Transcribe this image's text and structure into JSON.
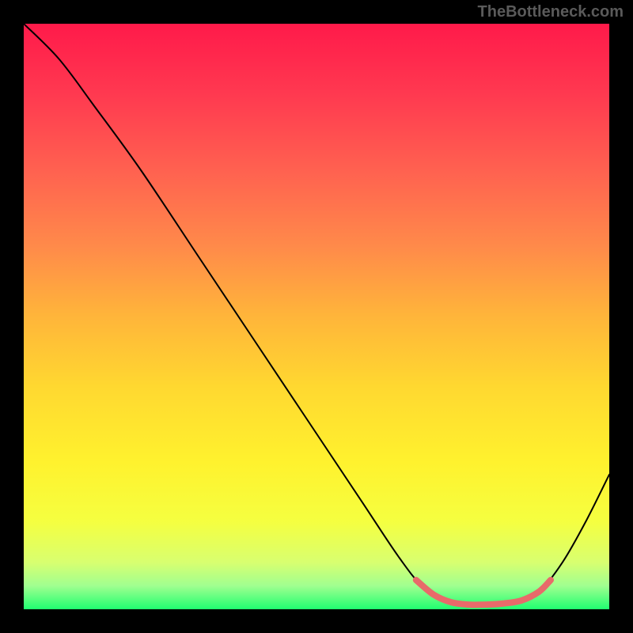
{
  "watermark": "TheBottleneck.com",
  "chart_data": {
    "type": "line",
    "title": "",
    "xlabel": "",
    "ylabel": "",
    "xlim": [
      0,
      100
    ],
    "ylim": [
      0,
      100
    ],
    "gradient_stops": [
      {
        "offset": 0,
        "color": "#ff1a4a"
      },
      {
        "offset": 12,
        "color": "#ff3950"
      },
      {
        "offset": 25,
        "color": "#ff6150"
      },
      {
        "offset": 38,
        "color": "#ff8a4a"
      },
      {
        "offset": 50,
        "color": "#ffb53a"
      },
      {
        "offset": 62,
        "color": "#ffd830"
      },
      {
        "offset": 75,
        "color": "#fff22e"
      },
      {
        "offset": 85,
        "color": "#f5ff40"
      },
      {
        "offset": 92,
        "color": "#d8ff70"
      },
      {
        "offset": 96,
        "color": "#a0ff90"
      },
      {
        "offset": 100,
        "color": "#20ff70"
      }
    ],
    "series": [
      {
        "name": "bottleneck-curve",
        "color": "#000000",
        "width": 2,
        "points": [
          {
            "x": 0,
            "y": 100
          },
          {
            "x": 6,
            "y": 94
          },
          {
            "x": 12,
            "y": 86
          },
          {
            "x": 20,
            "y": 75
          },
          {
            "x": 30,
            "y": 60
          },
          {
            "x": 40,
            "y": 45
          },
          {
            "x": 50,
            "y": 30
          },
          {
            "x": 58,
            "y": 18
          },
          {
            "x": 64,
            "y": 9
          },
          {
            "x": 68,
            "y": 4
          },
          {
            "x": 72,
            "y": 1.5
          },
          {
            "x": 76,
            "y": 0.8
          },
          {
            "x": 80,
            "y": 0.8
          },
          {
            "x": 84,
            "y": 1.2
          },
          {
            "x": 88,
            "y": 3
          },
          {
            "x": 92,
            "y": 8
          },
          {
            "x": 96,
            "y": 15
          },
          {
            "x": 100,
            "y": 23
          }
        ]
      },
      {
        "name": "optimal-highlight",
        "color": "#e86a6a",
        "width": 8,
        "points": [
          {
            "x": 67,
            "y": 5
          },
          {
            "x": 70,
            "y": 2.5
          },
          {
            "x": 73,
            "y": 1.2
          },
          {
            "x": 76,
            "y": 0.8
          },
          {
            "x": 79,
            "y": 0.8
          },
          {
            "x": 82,
            "y": 1.0
          },
          {
            "x": 85,
            "y": 1.5
          },
          {
            "x": 88,
            "y": 3
          },
          {
            "x": 90,
            "y": 5
          }
        ]
      }
    ]
  }
}
